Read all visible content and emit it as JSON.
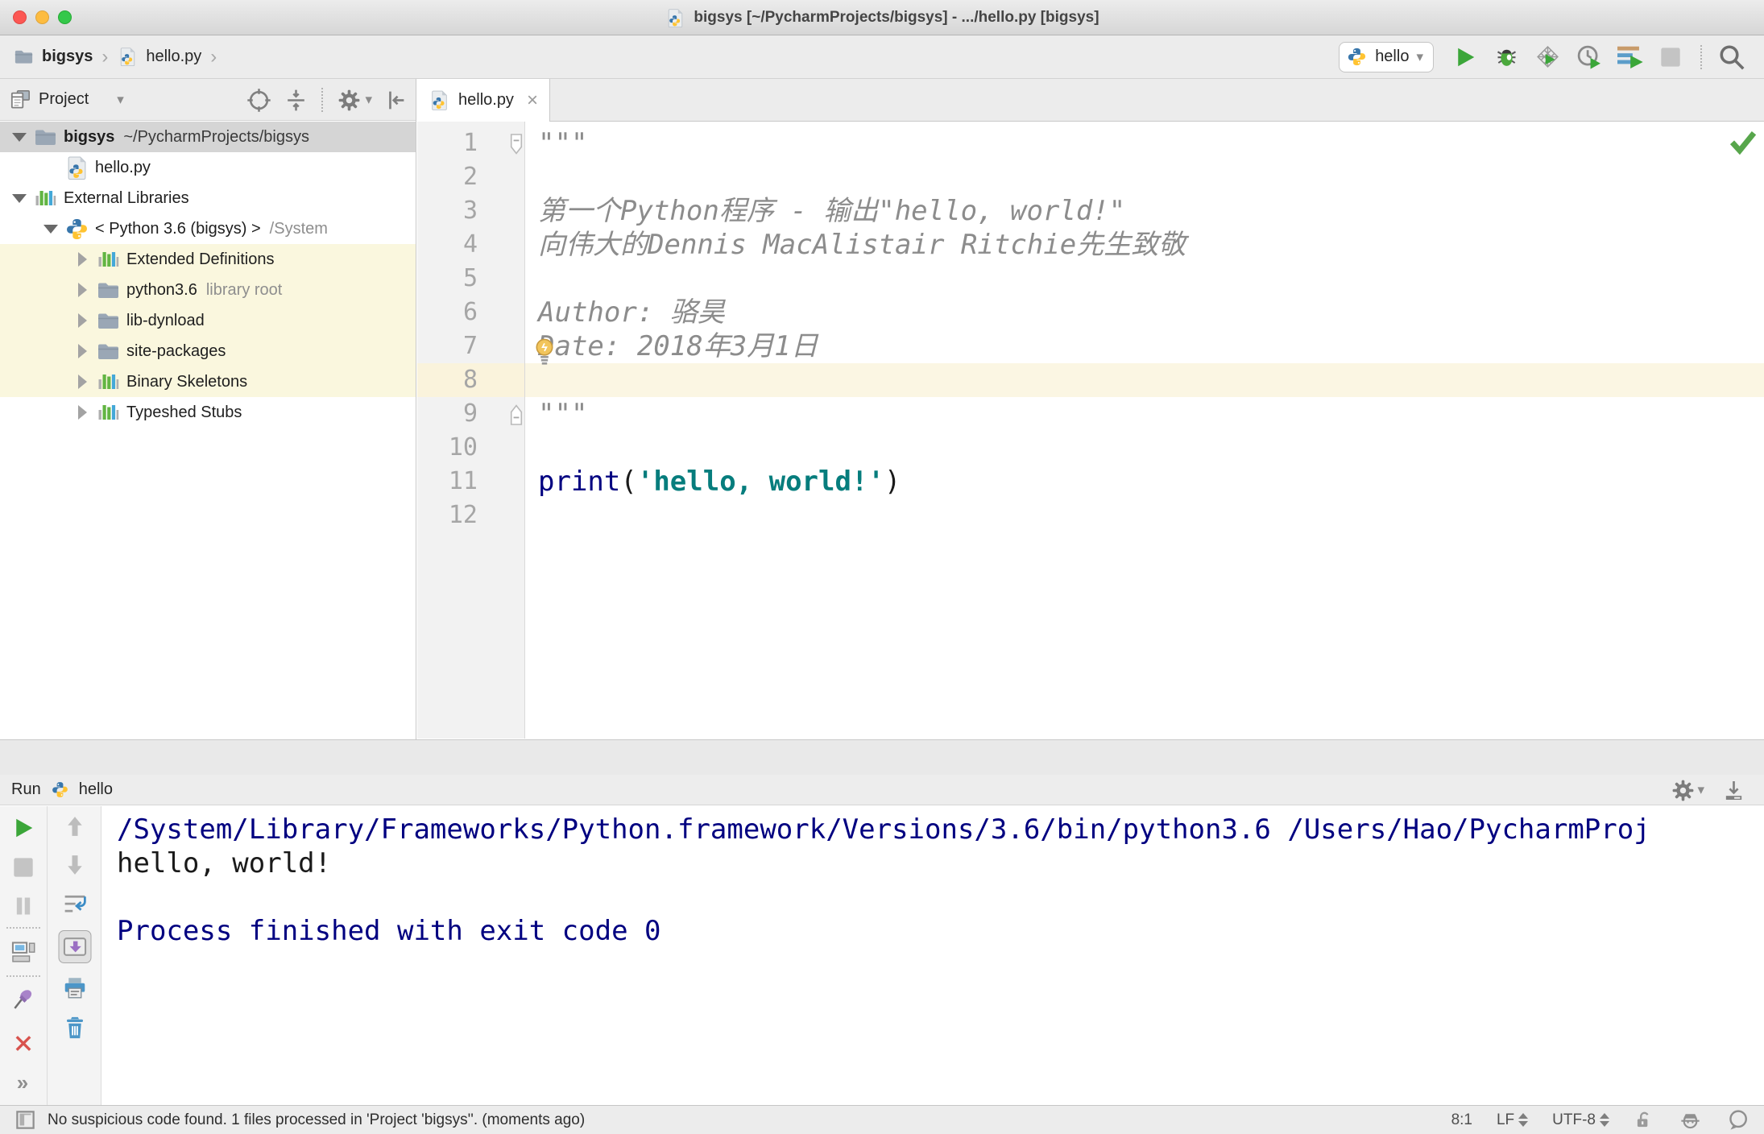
{
  "window": {
    "title": "bigsys [~/PycharmProjects/bigsys] - .../hello.py [bigsys]"
  },
  "icons": {
    "breadcrumb_separator": "›",
    "dropdown_arrow": "▾",
    "tab_close": "×",
    "more_chevrons": "»"
  },
  "colors": {
    "run_green": "#3BA639",
    "keyword": "#000080",
    "string": "#067D7D",
    "docstring": "#8C8C8C",
    "console_system": "#000080",
    "tree_highlight": "#FAF7DE",
    "caret_line_bg": "#FBF6E3",
    "selection_bg": "#D5D5D5"
  },
  "navbar": {
    "breadcrumbs": [
      "bigsys",
      "hello.py"
    ],
    "run_config_label": "hello"
  },
  "project": {
    "header_title": "Project",
    "tree": [
      {
        "label": "bigsys",
        "suffix": "~/PycharmProjects/bigsys",
        "suffix_style": "dark",
        "icon": "folder",
        "arrow": "expanded",
        "depth": 0,
        "selected": true,
        "bold": true
      },
      {
        "label": "hello.py",
        "icon": "python-file",
        "depth": 1
      },
      {
        "label": "External Libraries",
        "icon": "library",
        "arrow": "expanded",
        "depth": 0
      },
      {
        "label": "< Python 3.6 (bigsys) >",
        "suffix": "/System",
        "icon": "python",
        "arrow": "expanded",
        "depth": 1
      },
      {
        "label": "Extended Definitions",
        "icon": "library",
        "arrow": "collapsed",
        "depth": 2,
        "highlighted": true
      },
      {
        "label": "python3.6",
        "suffix": "library root",
        "icon": "folder",
        "arrow": "collapsed",
        "depth": 2,
        "highlighted": true
      },
      {
        "label": "lib-dynload",
        "icon": "folder",
        "arrow": "collapsed",
        "depth": 2,
        "highlighted": true
      },
      {
        "label": "site-packages",
        "icon": "folder",
        "arrow": "collapsed",
        "depth": 2,
        "highlighted": true
      },
      {
        "label": "Binary Skeletons",
        "icon": "library",
        "arrow": "collapsed",
        "depth": 2,
        "highlighted": true
      },
      {
        "label": "Typeshed Stubs",
        "icon": "library",
        "arrow": "collapsed",
        "depth": 2
      }
    ]
  },
  "editor": {
    "tab_label": "hello.py",
    "caret_line": 8,
    "lines": [
      {
        "n": 1,
        "fold": "start",
        "seg": [
          {
            "t": "\"\"\"",
            "s": "doc"
          }
        ]
      },
      {
        "n": 2,
        "seg": []
      },
      {
        "n": 3,
        "seg": [
          {
            "t": "第一个Python程序 - 输出\"hello, world!\"",
            "s": "doc"
          }
        ]
      },
      {
        "n": 4,
        "seg": [
          {
            "t": "向伟大的Dennis MacAlistair Ritchie先生致敬",
            "s": "doc"
          }
        ]
      },
      {
        "n": 5,
        "seg": []
      },
      {
        "n": 6,
        "seg": [
          {
            "t": "Author: 骆昊",
            "s": "doc"
          }
        ]
      },
      {
        "n": 7,
        "seg": [
          {
            "t": "Date: 2018年3月1日",
            "s": "doc"
          }
        ]
      },
      {
        "n": 8,
        "caret": true,
        "seg": []
      },
      {
        "n": 9,
        "fold": "end",
        "seg": [
          {
            "t": "\"\"\"",
            "s": "doc"
          }
        ]
      },
      {
        "n": 10,
        "seg": []
      },
      {
        "n": 11,
        "seg": [
          {
            "t": "print",
            "s": "kw"
          },
          {
            "t": "(",
            "s": "plain"
          },
          {
            "t": "'hello, world!'",
            "s": "str"
          },
          {
            "t": ")",
            "s": "plain"
          }
        ]
      },
      {
        "n": 12,
        "seg": []
      }
    ]
  },
  "run": {
    "title": "Run",
    "config": "hello",
    "console": [
      {
        "t": "/System/Library/Frameworks/Python.framework/Versions/3.6/bin/python3.6 /Users/Hao/PycharmProj",
        "s": "system"
      },
      {
        "t": "hello, world!",
        "s": "stdout"
      },
      {
        "t": "",
        "s": "stdout"
      },
      {
        "t": "Process finished with exit code 0",
        "s": "system"
      }
    ]
  },
  "status": {
    "message": "No suspicious code found. 1 files processed in 'Project 'bigsys''. (moments ago)",
    "caret_position": "8:1",
    "line_separator": "LF",
    "encoding": "UTF-8"
  }
}
